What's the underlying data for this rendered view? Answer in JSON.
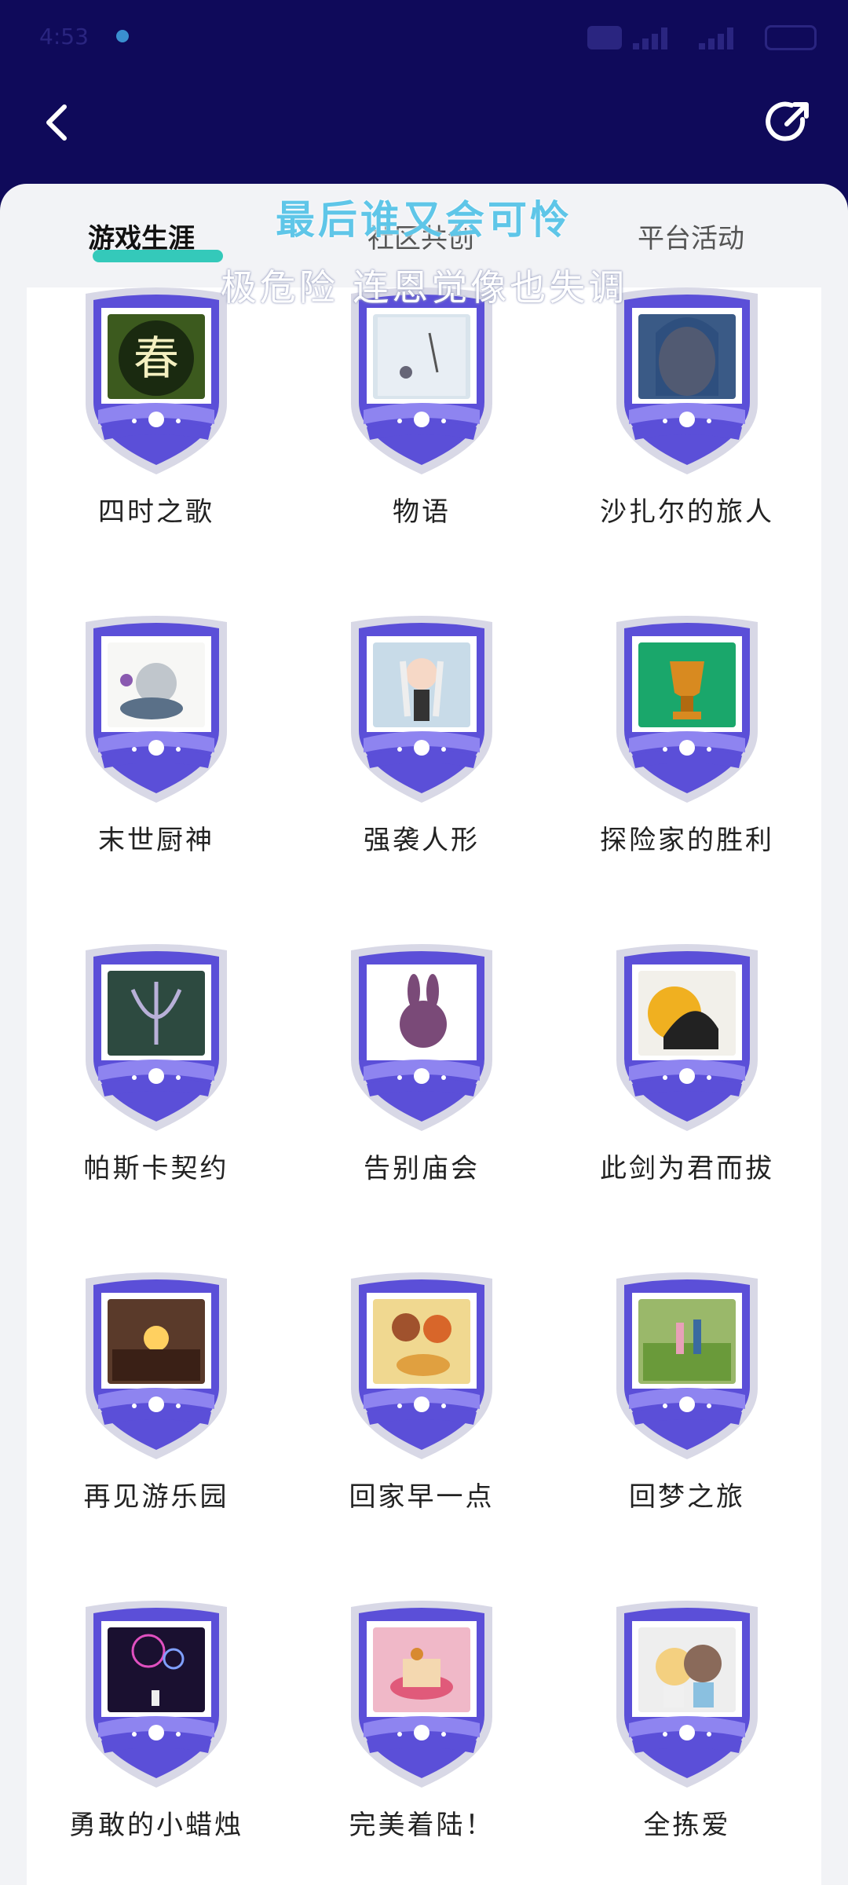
{
  "status_bar": {
    "time": "4:53"
  },
  "header": {
    "back_icon": "chevron-left-icon",
    "share_icon": "share-icon"
  },
  "tabs": [
    {
      "label": "游戏生涯",
      "active": true
    },
    {
      "label": "社区共创",
      "active": false
    },
    {
      "label": "平台活动",
      "active": false
    }
  ],
  "overlay_lyrics": {
    "line1": "最后谁又会可怜",
    "line2": "极危险 连恩觉像也失调"
  },
  "badges": [
    {
      "name": "四时之歌",
      "art": "spring",
      "bg": "#3c5a1e"
    },
    {
      "name": "物语",
      "art": "snow",
      "bg": "#d9e4ec"
    },
    {
      "name": "沙扎尔的旅人",
      "art": "traveler",
      "bg": "#3a5a86"
    },
    {
      "name": "末世厨神",
      "art": "chef",
      "bg": "#f7f7f5"
    },
    {
      "name": "强袭人形",
      "art": "doll",
      "bg": "#c8dbe8"
    },
    {
      "name": "探险家的胜利",
      "art": "trophy",
      "bg": "#1aa76b"
    },
    {
      "name": "帕斯卡契约",
      "art": "emblem",
      "bg": "#2d4a40"
    },
    {
      "name": "告别庙会",
      "art": "bunny",
      "bg": "#ffffff"
    },
    {
      "name": "此剑为君而拔",
      "art": "sword",
      "bg": "#f2f0ea"
    },
    {
      "name": "再见游乐园",
      "art": "sunset",
      "bg": "#5a3a2a"
    },
    {
      "name": "回家早一点",
      "art": "family",
      "bg": "#f0d890"
    },
    {
      "name": "回梦之旅",
      "art": "field",
      "bg": "#9ab86a"
    },
    {
      "name": "勇敢的小蜡烛",
      "art": "fireworks",
      "bg": "#1a1030"
    },
    {
      "name": "完美着陆！",
      "art": "cake",
      "bg": "#f0b8c8"
    },
    {
      "name": "全拣爱",
      "art": "couple",
      "bg": "#eeeeee"
    }
  ],
  "colors": {
    "header_bg": "#0f0a5a",
    "accent": "#1fc4b4",
    "badge_ring": "#5b4fd8",
    "badge_ring_light": "#8e84f0"
  }
}
